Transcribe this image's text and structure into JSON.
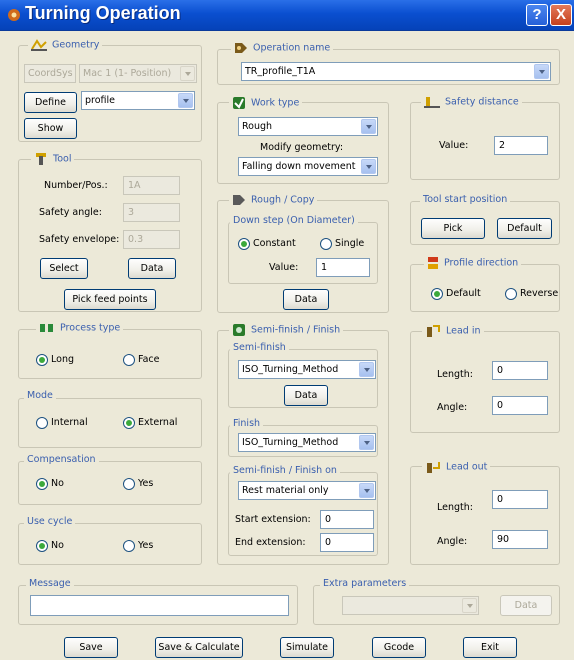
{
  "window": {
    "title": "Turning Operation",
    "help": "?",
    "close": "X"
  },
  "geometry": {
    "label": "Geometry",
    "coordsys": "CoordSys",
    "machine": "Mac 1 (1- Position)",
    "define": "Define",
    "profile": "profile",
    "show": "Show"
  },
  "tool": {
    "label": "Tool",
    "number_label": "Number/Pos.:",
    "number_value": "1A",
    "safety_angle_label": "Safety angle:",
    "safety_angle_value": "3",
    "safety_env_label": "Safety envelope:",
    "safety_env_value": "0.3",
    "select": "Select",
    "data": "Data",
    "pick_feed": "Pick feed points"
  },
  "process_type": {
    "label": "Process type",
    "long": "Long",
    "face": "Face",
    "selected": "Long"
  },
  "mode": {
    "label": "Mode",
    "internal": "Internal",
    "external": "External",
    "selected": "External"
  },
  "compensation": {
    "label": "Compensation",
    "no": "No",
    "yes": "Yes",
    "selected": "No"
  },
  "use_cycle": {
    "label": "Use cycle",
    "no": "No",
    "yes": "Yes",
    "selected": "No"
  },
  "operation_name": {
    "label": "Operation name",
    "value": "TR_profile_T1A"
  },
  "work_type": {
    "label": "Work type",
    "value": "Rough",
    "modify_label": "Modify geometry:",
    "modify_value": "Falling down movement"
  },
  "rough_copy": {
    "label": "Rough / Copy",
    "down_step_label": "Down step (On Diameter)",
    "constant": "Constant",
    "single": "Single",
    "selected": "Constant",
    "value_label": "Value:",
    "value": "1",
    "data": "Data"
  },
  "semi_finish_finish": {
    "label": "Semi-finish / Finish",
    "semi_label": "Semi-finish",
    "semi_value": "ISO_Turning_Method",
    "data": "Data",
    "finish_label": "Finish",
    "finish_value": "ISO_Turning_Method",
    "on_label": "Semi-finish / Finish on",
    "on_value": "Rest material only",
    "start_ext_label": "Start extension:",
    "start_ext_value": "0",
    "end_ext_label": "End extension:",
    "end_ext_value": "0"
  },
  "safety_distance": {
    "label": "Safety distance",
    "value_label": "Value:",
    "value": "2"
  },
  "tool_start": {
    "label": "Tool start position",
    "pick": "Pick",
    "default": "Default"
  },
  "profile_direction": {
    "label": "Profile direction",
    "default": "Default",
    "reverse": "Reverse",
    "selected": "Default"
  },
  "lead_in": {
    "label": "Lead in",
    "length_label": "Length:",
    "length_value": "0",
    "angle_label": "Angle:",
    "angle_value": "0"
  },
  "lead_out": {
    "label": "Lead out",
    "length_label": "Length:",
    "length_value": "0",
    "angle_label": "Angle:",
    "angle_value": "90"
  },
  "message": {
    "label": "Message",
    "value": ""
  },
  "extra": {
    "label": "Extra parameters",
    "data": "Data"
  },
  "footer": {
    "save": "Save",
    "save_calc": "Save & Calculate",
    "simulate": "Simulate",
    "gcode": "Gcode",
    "exit": "Exit"
  },
  "colors": {
    "title_bar": "#0a4fd0",
    "group_label": "#3a5fae",
    "window_bg": "#ece9d8",
    "radio_dot": "#3ca93c"
  },
  "icons": [
    "app-gear-icon",
    "geometry-icon",
    "tool-icon",
    "process-type-icon",
    "operation-name-icon",
    "work-type-icon",
    "rough-copy-icon",
    "semi-finish-icon",
    "safety-distance-icon",
    "profile-direction-icon",
    "lead-in-icon",
    "lead-out-icon"
  ]
}
